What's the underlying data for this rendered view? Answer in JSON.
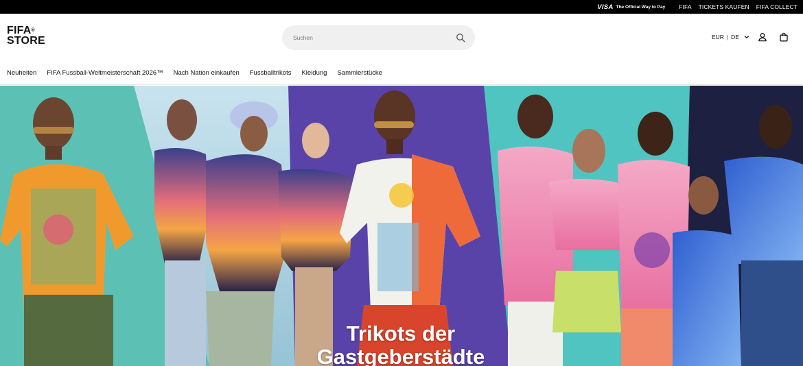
{
  "topbar": {
    "visa_logo": "VISA",
    "visa_tagline": "The Official Way to Pay",
    "links": [
      "FIFA",
      "TICKETS KAUFEN",
      "FIFA COLLECT"
    ]
  },
  "header": {
    "logo_line1": "FIFA",
    "logo_line2": "STORE",
    "logo_reg": "®",
    "search_placeholder": "Suchen",
    "currency": "EUR",
    "language": "DE",
    "icons": [
      "search-icon",
      "chevron-down-icon",
      "user-icon",
      "bag-icon"
    ]
  },
  "nav": {
    "items": [
      "Neuheiten",
      "FIFA Fussball-Weltmeisterschaft 2026™",
      "Nach Nation einkaufen",
      "Fussballtrikots",
      "Kleidung",
      "Sammlerstücke"
    ]
  },
  "hero": {
    "title_line1": "Trikots der",
    "title_line2": "Gastgeberstädte"
  },
  "colors": {
    "topbar_bg": "#000000",
    "panel_teal": "#5cc0b5",
    "panel_sky": "#a9cfe0",
    "panel_purple": "#5a43a8",
    "panel_turquoise": "#4fc4c0",
    "panel_navy": "#1d2040"
  }
}
